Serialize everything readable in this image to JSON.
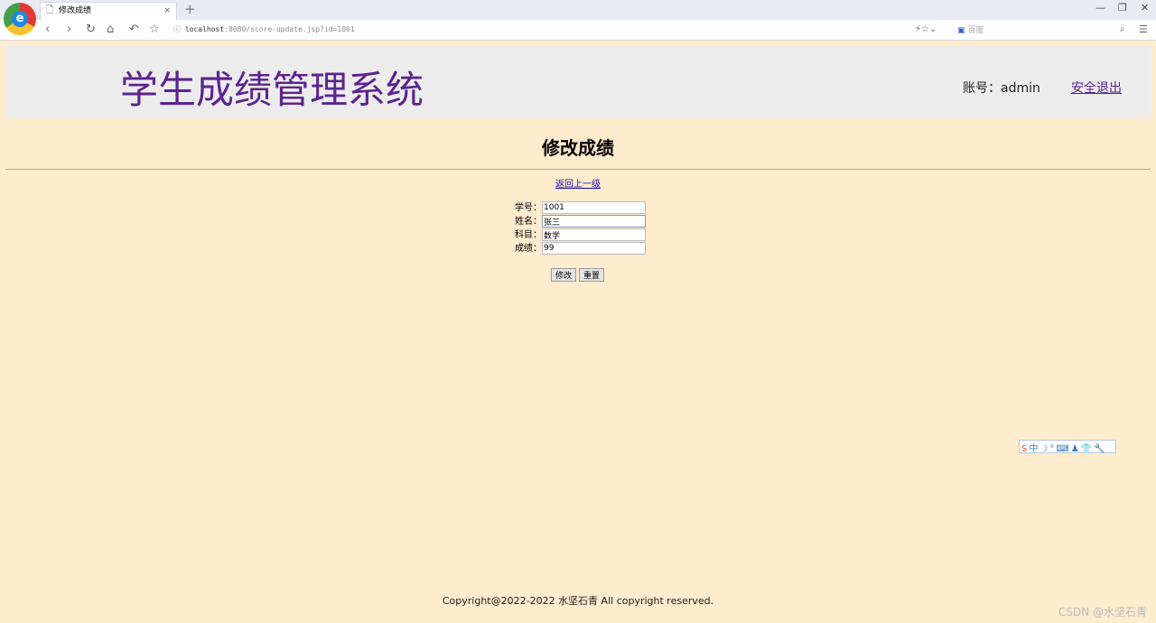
{
  "browser": {
    "tab_title": "修改成绩",
    "url_host": "localhost",
    "url_rest": ":8080/score-update.jsp?id=1001",
    "search_placeholder": "百度"
  },
  "header": {
    "title": "学生成绩管理系统",
    "account": "账号：admin",
    "logout": "安全退出"
  },
  "page": {
    "heading": "修改成绩",
    "back_link": "返回上一级"
  },
  "form": {
    "fields": [
      {
        "label": "学号：",
        "value": "1001"
      },
      {
        "label": "姓名：",
        "value": "张三"
      },
      {
        "label": "科目：",
        "value": "数学"
      },
      {
        "label": "成绩：",
        "value": "99"
      }
    ],
    "submit": "修改",
    "reset": "重置"
  },
  "ime": {
    "label": "中"
  },
  "footer": "Copyright@2022-2022 水坚石青 All copyright reserved.",
  "watermark": "CSDN @水坚石青"
}
